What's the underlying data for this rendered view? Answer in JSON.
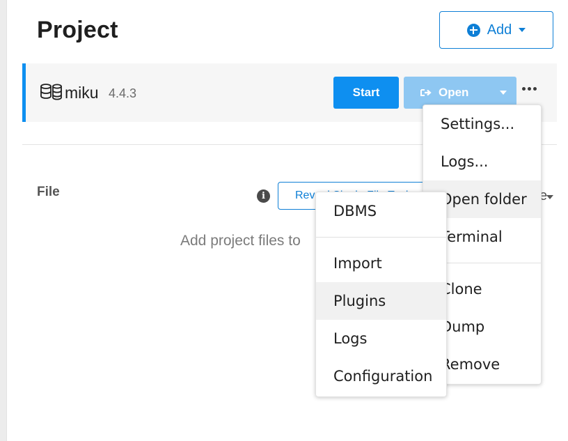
{
  "page": {
    "title": "Project"
  },
  "header": {
    "add_label": "Add"
  },
  "dbms": {
    "name": "miku",
    "version": "4.4.3",
    "start_label": "Start",
    "open_label": "Open"
  },
  "file_section": {
    "title": "File",
    "reveal_label": "Reveal Single File Tools",
    "empty_hint": "Add project files to",
    "right_fragment": "e"
  },
  "more_menu": {
    "items": [
      "Settings...",
      "Logs...",
      "Open folder",
      "Terminal",
      "Clone",
      "Dump",
      "Remove"
    ]
  },
  "dbms_menu": {
    "items": [
      "DBMS",
      "Import",
      "Plugins",
      "Logs",
      "Configuration"
    ]
  },
  "colors": {
    "accent": "#0e8ff0",
    "accent_light": "#8ec7f2",
    "row_bg": "#f6f6f6"
  }
}
